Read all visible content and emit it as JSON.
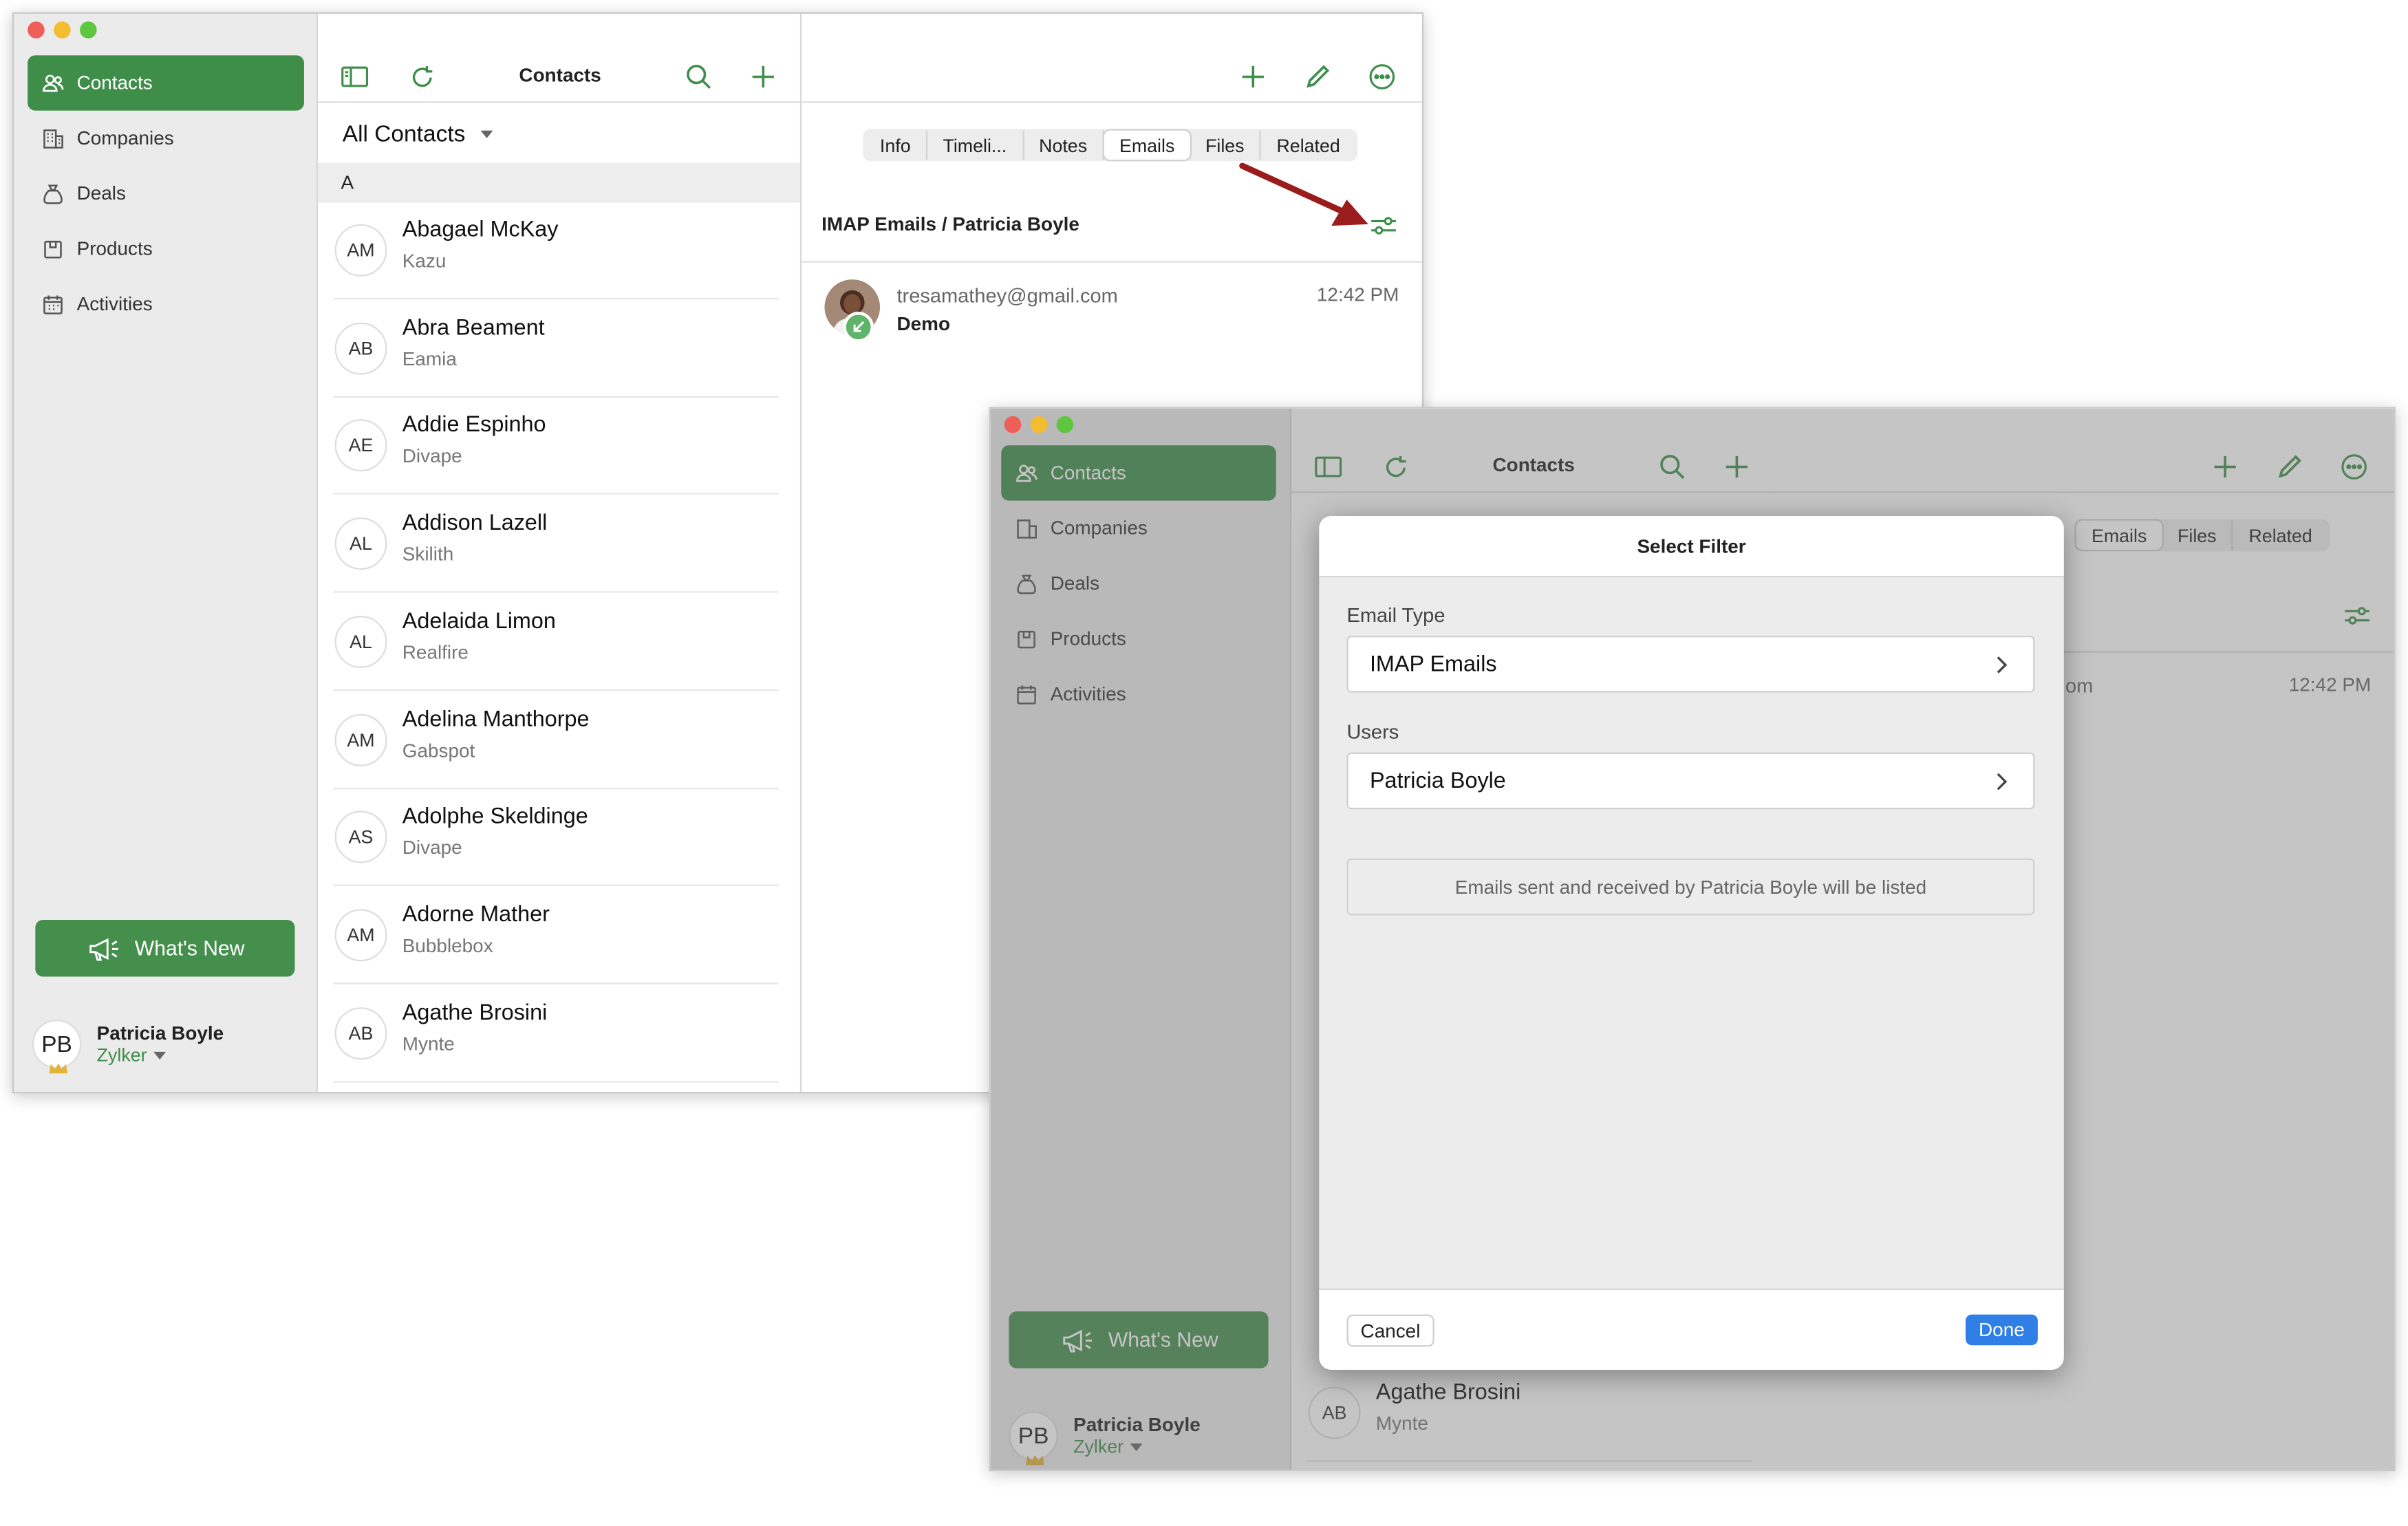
{
  "app": {
    "nav": [
      {
        "id": "contacts",
        "label": "Contacts",
        "active": true
      },
      {
        "id": "companies",
        "label": "Companies"
      },
      {
        "id": "deals",
        "label": "Deals"
      },
      {
        "id": "products",
        "label": "Products"
      },
      {
        "id": "activities",
        "label": "Activities"
      }
    ],
    "whats_new": "What's New",
    "user": {
      "initials": "PB",
      "name": "Patricia Boyle",
      "org": "Zylker"
    },
    "list": {
      "title": "Contacts",
      "filter": "All Contacts",
      "section": "A",
      "contacts": [
        {
          "initials": "AM",
          "name": "Abagael McKay",
          "company": "Kazu"
        },
        {
          "initials": "AB",
          "name": "Abra Beament",
          "company": "Eamia"
        },
        {
          "initials": "AE",
          "name": "Addie Espinho",
          "company": "Divape"
        },
        {
          "initials": "AL",
          "name": "Addison Lazell",
          "company": "Skilith"
        },
        {
          "initials": "AL",
          "name": "Adelaida Limon",
          "company": "Realfire"
        },
        {
          "initials": "AM",
          "name": "Adelina Manthorpe",
          "company": "Gabspot"
        },
        {
          "initials": "AS",
          "name": "Adolphe Skeldinge",
          "company": "Divape"
        },
        {
          "initials": "AM",
          "name": "Adorne Mather",
          "company": "Bubblebox"
        },
        {
          "initials": "AB",
          "name": "Agathe Brosini",
          "company": "Mynte"
        }
      ]
    },
    "detail": {
      "tabs": [
        "Info",
        "Timeli...",
        "Notes",
        "Emails",
        "Files",
        "Related"
      ],
      "selected_tab": "Emails",
      "breadcrumb": "IMAP Emails / Patricia Boyle",
      "email": {
        "from": "tresamathey@gmail.com",
        "subject": "Demo",
        "time": "12:42 PM"
      }
    }
  },
  "window2": {
    "partial_email_from": "om",
    "modal": {
      "title": "Select Filter",
      "email_type_label": "Email Type",
      "email_type_value": "IMAP Emails",
      "users_label": "Users",
      "users_value": "Patricia Boyle",
      "note": "Emails sent and received by Patricia Boyle will be listed",
      "cancel": "Cancel",
      "done": "Done"
    }
  },
  "colors": {
    "accent": "#3e8e4a",
    "done_button": "#2f7fe6",
    "annotation_arrow": "#9b1c1c"
  }
}
